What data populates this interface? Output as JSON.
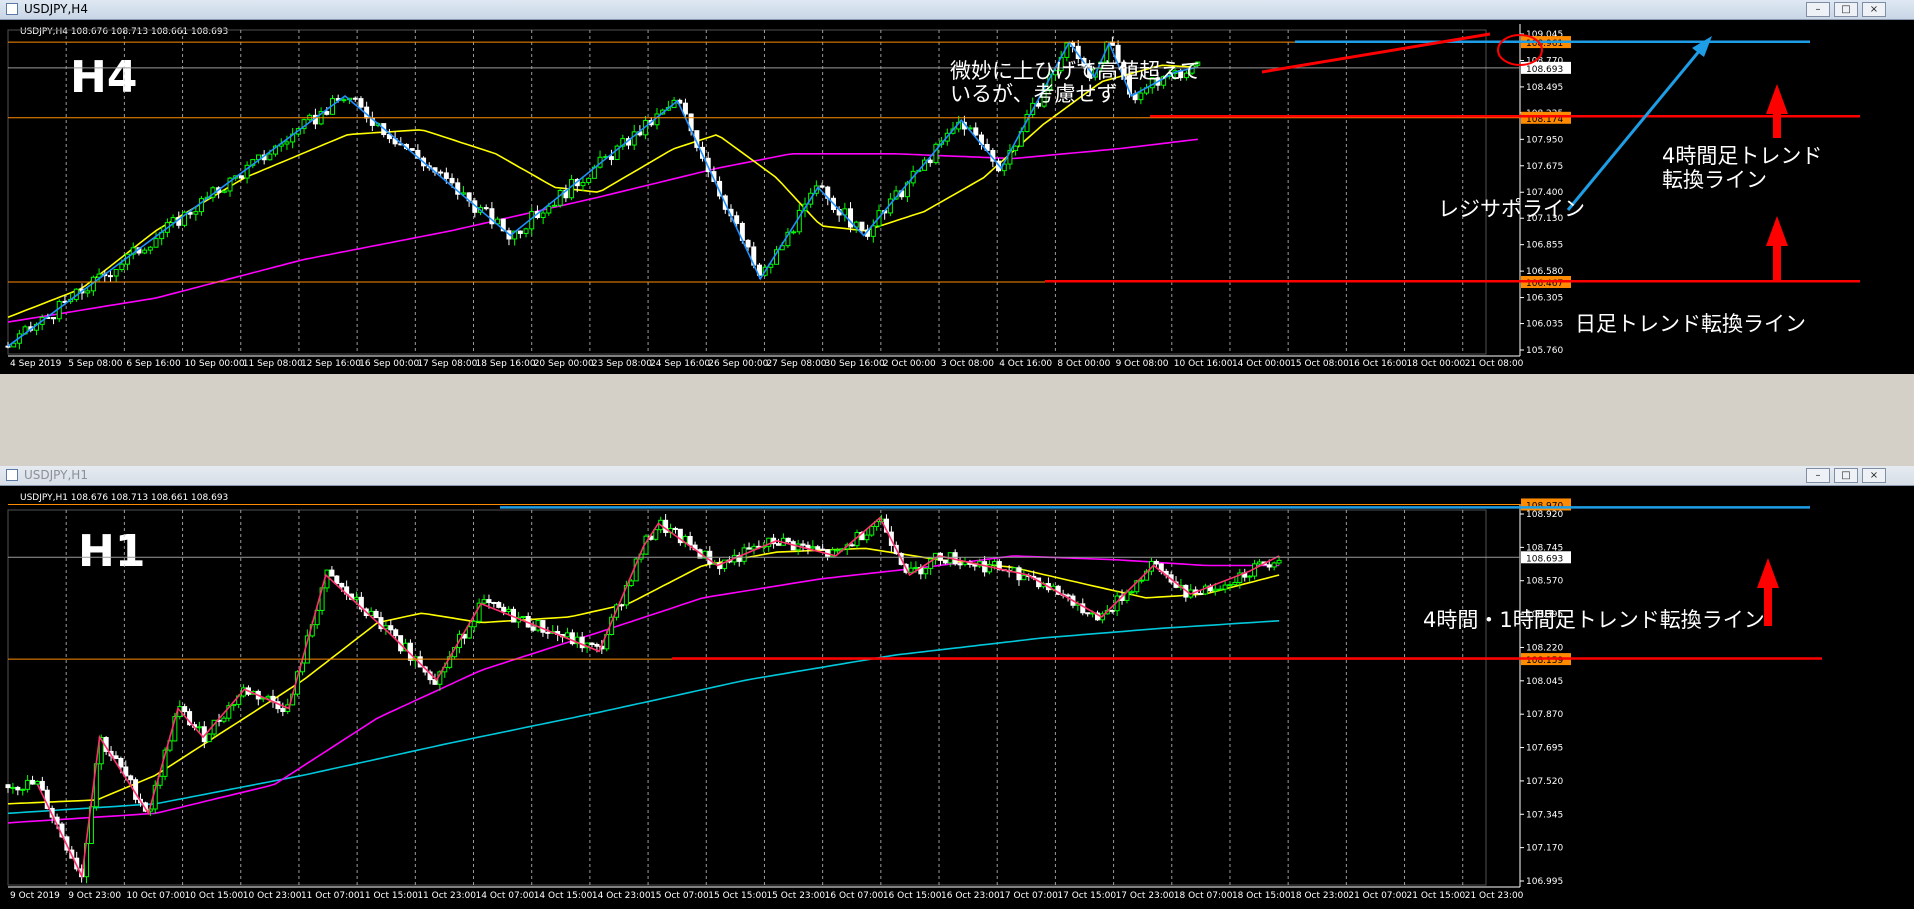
{
  "top_window": {
    "title": "USDJPY,H4",
    "buttons": [
      "–",
      "□",
      "×"
    ],
    "header_info": "USDJPY,H4  108.676 108.713 108.661 108.693",
    "timeframe_label": "H4"
  },
  "bottom_window": {
    "title": "USDJPY,H1",
    "buttons": [
      "–",
      "□",
      "×"
    ],
    "header_info": "USDJPY,H1  108.676 108.713 108.661 108.693",
    "timeframe_label": "H1"
  },
  "colors": {
    "background": "#000000",
    "bull_candle": "#00ff00",
    "bear_candle": "#ffffff",
    "ma_fast": "#ffff00",
    "ma_mid": "#ff00ff",
    "ma_slow": "#00c8dc",
    "zigzag_h4": "#1e90ff",
    "zigzag_h1": "#ff3070",
    "annotation_red": "#ff0000",
    "annotation_blue": "#1e9ee6",
    "price_line_orange": "#ff8c00"
  },
  "chart_data": [
    {
      "type": "candlestick",
      "title": "USDJPY,H4",
      "ylim": [
        105.76,
        109.045
      ],
      "y_ticks": [
        "109.045",
        "108.770",
        "108.495",
        "108.225",
        "107.950",
        "107.675",
        "107.400",
        "107.130",
        "106.855",
        "106.580",
        "106.305",
        "106.035",
        "105.760"
      ],
      "price_labels": [
        {
          "value": 108.961,
          "text": "108.961",
          "kind": "orange"
        },
        {
          "value": 108.693,
          "text": "108.693",
          "kind": "current"
        },
        {
          "value": 108.174,
          "text": "108.174",
          "kind": "orange"
        },
        {
          "value": 106.467,
          "text": "106.467",
          "kind": "orange"
        }
      ],
      "x_labels": [
        "4 Sep 2019",
        "5 Sep 08:00",
        "6 Sep 16:00",
        "10 Sep 00:00",
        "11 Sep 08:00",
        "12 Sep 16:00",
        "16 Sep 00:00",
        "17 Sep 08:00",
        "18 Sep 16:00",
        "20 Sep 00:00",
        "23 Sep 08:00",
        "24 Sep 16:00",
        "26 Sep 00:00",
        "27 Sep 08:00",
        "30 Sep 16:00",
        "2 Oct 00:00",
        "3 Oct 08:00",
        "4 Oct 16:00",
        "8 Oct 00:00",
        "9 Oct 08:00",
        "10 Oct 16:00",
        "14 Oct 00:00",
        "15 Oct 08:00",
        "16 Oct 16:00",
        "18 Oct 00:00",
        "21 Oct 08:00"
      ],
      "swings": [
        {
          "x": 0,
          "y": 105.8
        },
        {
          "x": 0.228,
          "y": 108.4
        },
        {
          "x": 0.34,
          "y": 106.95
        },
        {
          "x": 0.453,
          "y": 108.35
        },
        {
          "x": 0.509,
          "y": 106.5
        },
        {
          "x": 0.548,
          "y": 107.45
        },
        {
          "x": 0.579,
          "y": 106.95
        },
        {
          "x": 0.645,
          "y": 108.15
        },
        {
          "x": 0.672,
          "y": 107.65
        },
        {
          "x": 0.718,
          "y": 108.96
        },
        {
          "x": 0.735,
          "y": 108.6
        },
        {
          "x": 0.745,
          "y": 108.95
        },
        {
          "x": 0.76,
          "y": 108.4
        },
        {
          "x": 0.79,
          "y": 108.65
        },
        {
          "x": 0.805,
          "y": 108.7
        }
      ],
      "ma_fast": [
        [
          0,
          106.1
        ],
        [
          0.05,
          106.4
        ],
        [
          0.1,
          107.0
        ],
        [
          0.16,
          107.55
        ],
        [
          0.23,
          108.0
        ],
        [
          0.28,
          108.05
        ],
        [
          0.33,
          107.8
        ],
        [
          0.37,
          107.45
        ],
        [
          0.4,
          107.4
        ],
        [
          0.45,
          107.85
        ],
        [
          0.48,
          108.0
        ],
        [
          0.52,
          107.55
        ],
        [
          0.55,
          107.05
        ],
        [
          0.58,
          107.0
        ],
        [
          0.62,
          107.2
        ],
        [
          0.66,
          107.55
        ],
        [
          0.7,
          108.1
        ],
        [
          0.74,
          108.55
        ],
        [
          0.78,
          108.72
        ],
        [
          0.805,
          108.7
        ]
      ],
      "ma_mid": [
        [
          0,
          106.05
        ],
        [
          0.1,
          106.3
        ],
        [
          0.2,
          106.7
        ],
        [
          0.3,
          107.0
        ],
        [
          0.4,
          107.35
        ],
        [
          0.48,
          107.65
        ],
        [
          0.53,
          107.8
        ],
        [
          0.6,
          107.8
        ],
        [
          0.68,
          107.75
        ],
        [
          0.75,
          107.85
        ],
        [
          0.805,
          107.95
        ]
      ],
      "annotations": [
        {
          "text": "微妙に上ひげで高値超えて",
          "color": "#ffffff"
        },
        {
          "text": "いるが、考慮せず",
          "color": "#ffffff"
        },
        {
          "text": "レジサポライン",
          "color": "#ffffff"
        },
        {
          "text": "4時間足トレンド",
          "color": "#ffffff"
        },
        {
          "text": "転換ライン",
          "color": "#ffffff"
        },
        {
          "text": "日足トレンド転換ライン",
          "color": "#ffffff"
        }
      ]
    },
    {
      "type": "candlestick",
      "title": "USDJPY,H1",
      "ylim": [
        106.995,
        108.92
      ],
      "y_ticks": [
        "108.920",
        "108.745",
        "108.570",
        "108.395",
        "108.220",
        "108.045",
        "107.870",
        "107.695",
        "107.520",
        "107.345",
        "107.170",
        "106.995"
      ],
      "price_labels": [
        {
          "value": 108.97,
          "text": "108.970",
          "kind": "orange"
        },
        {
          "value": 108.693,
          "text": "108.693",
          "kind": "current"
        },
        {
          "value": 108.159,
          "text": "108.159",
          "kind": "orange"
        }
      ],
      "x_labels": [
        "9 Oct 2019",
        "9 Oct 23:00",
        "10 Oct 07:00",
        "10 Oct 15:00",
        "10 Oct 23:00",
        "11 Oct 07:00",
        "11 Oct 15:00",
        "11 Oct 23:00",
        "14 Oct 07:00",
        "14 Oct 15:00",
        "14 Oct 23:00",
        "15 Oct 07:00",
        "15 Oct 15:00",
        "15 Oct 23:00",
        "16 Oct 07:00",
        "16 Oct 15:00",
        "16 Oct 23:00",
        "17 Oct 07:00",
        "17 Oct 15:00",
        "17 Oct 23:00",
        "18 Oct 07:00",
        "18 Oct 15:00",
        "18 Oct 23:00",
        "21 Oct 07:00",
        "21 Oct 15:00",
        "21 Oct 23:00"
      ],
      "swings": [
        {
          "x": 0.02,
          "y": 107.5
        },
        {
          "x": 0.05,
          "y": 107.02
        },
        {
          "x": 0.062,
          "y": 107.75
        },
        {
          "x": 0.095,
          "y": 107.35
        },
        {
          "x": 0.115,
          "y": 107.9
        },
        {
          "x": 0.132,
          "y": 107.75
        },
        {
          "x": 0.16,
          "y": 108.0
        },
        {
          "x": 0.19,
          "y": 107.9
        },
        {
          "x": 0.215,
          "y": 108.6
        },
        {
          "x": 0.26,
          "y": 108.28
        },
        {
          "x": 0.29,
          "y": 108.05
        },
        {
          "x": 0.32,
          "y": 108.45
        },
        {
          "x": 0.4,
          "y": 108.2
        },
        {
          "x": 0.43,
          "y": 108.75
        },
        {
          "x": 0.44,
          "y": 108.87
        },
        {
          "x": 0.48,
          "y": 108.65
        },
        {
          "x": 0.52,
          "y": 108.78
        },
        {
          "x": 0.56,
          "y": 108.7
        },
        {
          "x": 0.59,
          "y": 108.9
        },
        {
          "x": 0.61,
          "y": 108.6
        },
        {
          "x": 0.63,
          "y": 108.7
        },
        {
          "x": 0.69,
          "y": 108.6
        },
        {
          "x": 0.74,
          "y": 108.38
        },
        {
          "x": 0.775,
          "y": 108.65
        },
        {
          "x": 0.8,
          "y": 108.5
        },
        {
          "x": 0.84,
          "y": 108.62
        },
        {
          "x": 0.86,
          "y": 108.7
        }
      ],
      "ma_fast": [
        [
          0,
          107.4
        ],
        [
          0.06,
          107.42
        ],
        [
          0.1,
          107.55
        ],
        [
          0.15,
          107.8
        ],
        [
          0.2,
          108.05
        ],
        [
          0.25,
          108.35
        ],
        [
          0.28,
          108.4
        ],
        [
          0.32,
          108.35
        ],
        [
          0.38,
          108.38
        ],
        [
          0.42,
          108.45
        ],
        [
          0.47,
          108.65
        ],
        [
          0.52,
          108.72
        ],
        [
          0.58,
          108.74
        ],
        [
          0.63,
          108.68
        ],
        [
          0.68,
          108.64
        ],
        [
          0.73,
          108.55
        ],
        [
          0.77,
          108.48
        ],
        [
          0.81,
          108.5
        ],
        [
          0.86,
          108.6
        ]
      ],
      "ma_mid": [
        [
          0,
          107.3
        ],
        [
          0.1,
          107.35
        ],
        [
          0.18,
          107.5
        ],
        [
          0.25,
          107.85
        ],
        [
          0.32,
          108.1
        ],
        [
          0.4,
          108.3
        ],
        [
          0.47,
          108.48
        ],
        [
          0.55,
          108.58
        ],
        [
          0.62,
          108.64
        ],
        [
          0.68,
          108.7
        ],
        [
          0.75,
          108.68
        ],
        [
          0.81,
          108.65
        ],
        [
          0.86,
          108.65
        ]
      ],
      "ma_slow": [
        [
          0,
          107.35
        ],
        [
          0.1,
          107.4
        ],
        [
          0.2,
          107.55
        ],
        [
          0.3,
          107.72
        ],
        [
          0.4,
          107.88
        ],
        [
          0.5,
          108.05
        ],
        [
          0.6,
          108.18
        ],
        [
          0.7,
          108.27
        ],
        [
          0.78,
          108.32
        ],
        [
          0.86,
          108.36
        ]
      ],
      "annotations": [
        {
          "text": "4時間・1時間足トレンド転換ライン",
          "color": "#ffffff"
        }
      ]
    }
  ]
}
